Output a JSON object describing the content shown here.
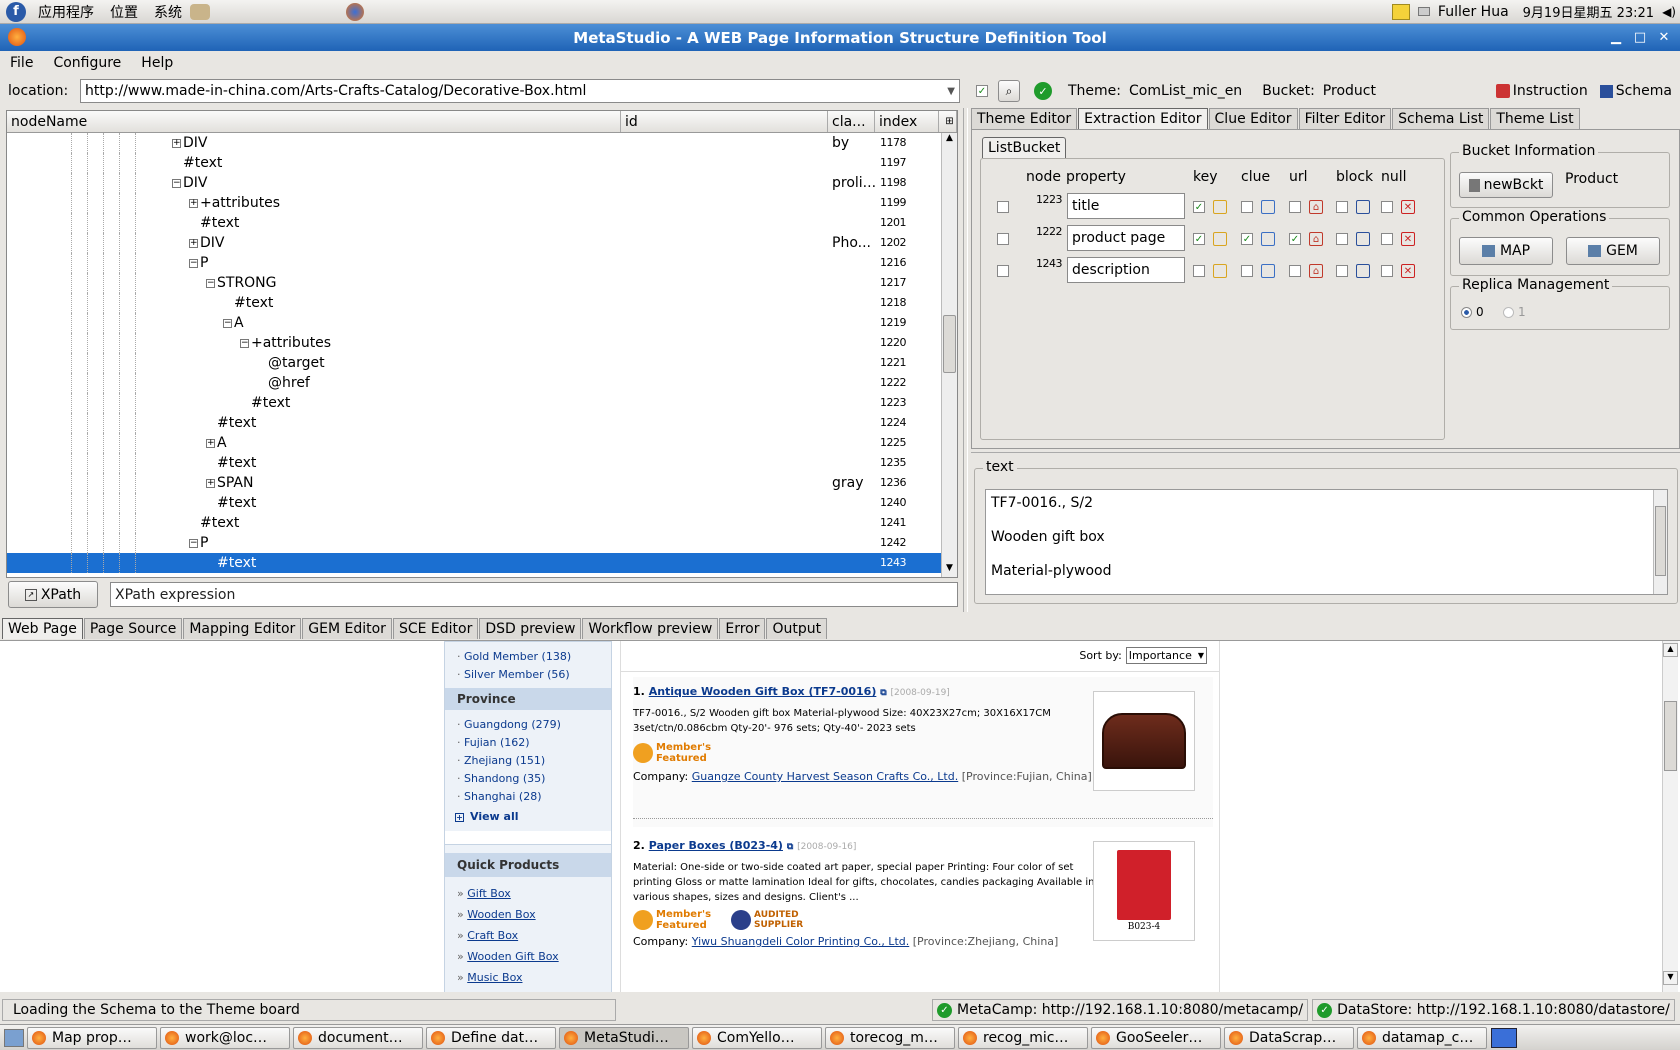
{
  "system_bar": {
    "applications": "应用程序",
    "places": "位置",
    "system": "系统",
    "user": "Fuller Hua",
    "clock": "9月19日星期五 23:21"
  },
  "window": {
    "title": "MetaStudio - A WEB Page Information Structure Definition Tool"
  },
  "menu": [
    "File",
    "Configure",
    "Help"
  ],
  "location": {
    "label": "location:",
    "url": "http://www.made-in-china.com/Arts-Crafts-Catalog/Decorative-Box.html",
    "theme_label": "Theme:",
    "theme": "ComList_mic_en",
    "bucket_label": "Bucket:",
    "bucket": "Product",
    "instruction": "Instruction",
    "schema": "Schema"
  },
  "tree": {
    "columns": [
      "nodeName",
      "id",
      "cla...",
      "index"
    ],
    "rows": [
      {
        "indent": 1,
        "exp": "+",
        "name": "DIV",
        "cls": "by",
        "index": "1178"
      },
      {
        "indent": 1,
        "exp": "",
        "name": "#text",
        "cls": "",
        "index": "1197"
      },
      {
        "indent": 1,
        "exp": "-",
        "name": "DIV",
        "cls": "proli...",
        "index": "1198"
      },
      {
        "indent": 2,
        "exp": "+",
        "name": "+attributes",
        "cls": "",
        "index": "1199"
      },
      {
        "indent": 2,
        "exp": "",
        "name": "#text",
        "cls": "",
        "index": "1201"
      },
      {
        "indent": 2,
        "exp": "+",
        "name": "DIV",
        "cls": "Pho...",
        "index": "1202"
      },
      {
        "indent": 2,
        "exp": "-",
        "name": "P",
        "cls": "",
        "index": "1216"
      },
      {
        "indent": 3,
        "exp": "-",
        "name": "STRONG",
        "cls": "",
        "index": "1217"
      },
      {
        "indent": 4,
        "exp": "",
        "name": "#text",
        "cls": "",
        "index": "1218"
      },
      {
        "indent": 4,
        "exp": "-",
        "name": "A",
        "cls": "",
        "index": "1219"
      },
      {
        "indent": 5,
        "exp": "-",
        "name": "+attributes",
        "cls": "",
        "index": "1220"
      },
      {
        "indent": 6,
        "exp": "",
        "name": "@target",
        "cls": "",
        "index": "1221"
      },
      {
        "indent": 6,
        "exp": "",
        "name": "@href",
        "cls": "",
        "index": "1222"
      },
      {
        "indent": 5,
        "exp": "",
        "name": "#text",
        "cls": "",
        "index": "1223"
      },
      {
        "indent": 3,
        "exp": "",
        "name": "#text",
        "cls": "",
        "index": "1224"
      },
      {
        "indent": 3,
        "exp": "+",
        "name": "A",
        "cls": "",
        "index": "1225"
      },
      {
        "indent": 3,
        "exp": "",
        "name": "#text",
        "cls": "",
        "index": "1235"
      },
      {
        "indent": 3,
        "exp": "+",
        "name": "SPAN",
        "cls": "gray",
        "index": "1236"
      },
      {
        "indent": 3,
        "exp": "",
        "name": "#text",
        "cls": "",
        "index": "1240"
      },
      {
        "indent": 2,
        "exp": "",
        "name": "#text",
        "cls": "",
        "index": "1241"
      },
      {
        "indent": 2,
        "exp": "-",
        "name": "P",
        "cls": "",
        "index": "1242"
      },
      {
        "indent": 3,
        "exp": "",
        "name": "#text",
        "cls": "",
        "index": "1243",
        "selected": true
      }
    ]
  },
  "xpath": {
    "button": "XPath",
    "placeholder": "XPath expression"
  },
  "editor_tabs": [
    "Theme Editor",
    "Extraction Editor",
    "Clue Editor",
    "Filter Editor",
    "Schema List",
    "Theme List"
  ],
  "bucket_tab": "ListBucket",
  "bucket_table": {
    "headers": [
      "node",
      "property",
      "key",
      "clue",
      "url",
      "block",
      "null"
    ],
    "rows": [
      {
        "node": "1223",
        "property": "title",
        "key": true,
        "clue": false,
        "url": false,
        "block": false,
        "null": false
      },
      {
        "node": "1222",
        "property": "product page",
        "key": true,
        "clue": true,
        "url": true,
        "block": false,
        "null": false
      },
      {
        "node": "1243",
        "property": "description",
        "key": false,
        "clue": false,
        "url": false,
        "block": false,
        "null": false
      }
    ]
  },
  "bucket_info": {
    "title": "Bucket Information",
    "new_button": "newBckt",
    "name": "Product"
  },
  "common_ops": {
    "title": "Common Operations",
    "map": "MAP",
    "gem": "GEM"
  },
  "replica": {
    "title": "Replica Management",
    "opt0": "0",
    "opt1": "1"
  },
  "text_panel": {
    "title": "text",
    "lines": [
      "TF7-0016., S/2",
      "Wooden gift box",
      "Material-plywood"
    ]
  },
  "bottom_tabs": [
    "Web Page",
    "Page Source",
    "Mapping Editor",
    "GEM Editor",
    "SCE Editor",
    "DSD preview",
    "Workflow preview",
    "Error",
    "Output"
  ],
  "web": {
    "members": [
      "Gold Member (138)",
      "Silver Member (56)"
    ],
    "province_title": "Province",
    "provinces": [
      "Guangdong (279)",
      "Fujian (162)",
      "Zhejiang (151)",
      "Shandong (35)",
      "Shanghai (28)"
    ],
    "view_all": "View all",
    "quick_title": "Quick Products",
    "quick": [
      "Gift Box",
      "Wooden Box",
      "Craft Box",
      "Wooden Gift Box",
      "Music Box"
    ],
    "sort_label": "Sort by:",
    "sort_value": "Importance",
    "items": [
      {
        "num": "1.",
        "title": "Antique Wooden Gift Box (TF7-0016)",
        "date": "[2008-09-19]",
        "desc": "TF7-0016., S/2 Wooden gift box Material-plywood Size: 40X23X27cm; 30X16X17CM 3set/ctn/0.086cbm Qty-20'- 976 sets; Qty-40'- 2023 sets",
        "badge": "Member's Featured",
        "company_label": "Company:",
        "company": "Guangze County Harvest Season Crafts Co., Ltd.",
        "province": "[Province:Fujian, China]",
        "img_caption": ""
      },
      {
        "num": "2.",
        "title": "Paper Boxes (B023-4)",
        "date": "[2008-09-16]",
        "desc": "Material: One-side or two-side coated art paper, special paper Printing: Four color of set printing Gloss or matte lamination Ideal for gifts, chocolates, candies packaging Available in various shapes, sizes and designs. Client's ...",
        "badge": "Member's Featured",
        "badge2": "AUDITED SUPPLIER",
        "company_label": "Company:",
        "company": "Yiwu Shuangdeli Color Printing Co., Ltd.",
        "province": "[Province:Zhejiang, China]",
        "img_caption": "B023-4"
      }
    ]
  },
  "status": {
    "message": "Loading the Schema to the Theme board",
    "metacamp": "MetaCamp: http://192.168.1.10:8080/metacamp/",
    "datastore": "DataStore: http://192.168.1.10:8080/datastore/"
  },
  "taskbar": [
    "Map prop…",
    "work@loc…",
    "document…",
    "Define dat…",
    "MetaStudi…",
    "ComYello…",
    "torecog_m…",
    "recog_mic…",
    "GooSeeler…",
    "DataScrap…",
    "datamap_c…"
  ],
  "colors": {
    "title_bar": "#1f63b6",
    "selection": "#1b6fd1",
    "link": "#0b3a8e"
  }
}
